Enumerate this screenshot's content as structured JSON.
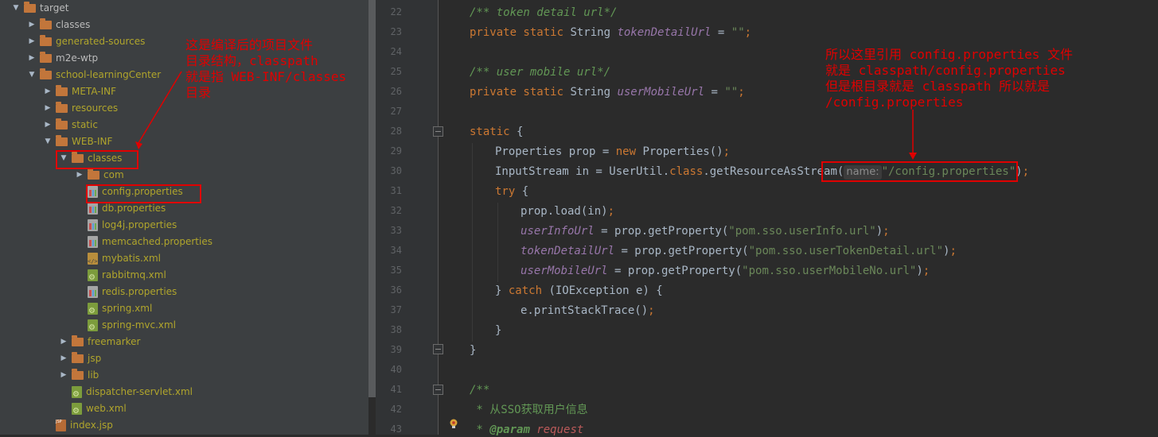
{
  "tree": {
    "items": [
      {
        "label": "target",
        "kind": "folder",
        "expanded": true,
        "color": "white"
      },
      {
        "label": "classes",
        "kind": "folder",
        "expanded": false,
        "color": "white"
      },
      {
        "label": "generated-sources",
        "kind": "folder",
        "expanded": false,
        "color": "yellow"
      },
      {
        "label": "m2e-wtp",
        "kind": "folder",
        "expanded": false,
        "color": "white"
      },
      {
        "label": "school-learningCenter",
        "kind": "folder",
        "expanded": true,
        "color": "yellow"
      },
      {
        "label": "META-INF",
        "kind": "folder",
        "expanded": false,
        "color": "yellow"
      },
      {
        "label": "resources",
        "kind": "folder",
        "expanded": false,
        "color": "yellow"
      },
      {
        "label": "static",
        "kind": "folder",
        "expanded": false,
        "color": "yellow"
      },
      {
        "label": "WEB-INF",
        "kind": "folder",
        "expanded": true,
        "color": "yellow"
      },
      {
        "label": "classes",
        "kind": "folder",
        "expanded": true,
        "color": "yellow"
      },
      {
        "label": "com",
        "kind": "folder",
        "expanded": false,
        "color": "yellow"
      },
      {
        "label": "config.properties",
        "kind": "properties",
        "color": "yellow"
      },
      {
        "label": "db.properties",
        "kind": "properties",
        "color": "yellow"
      },
      {
        "label": "log4j.properties",
        "kind": "properties",
        "color": "yellow"
      },
      {
        "label": "memcached.properties",
        "kind": "properties",
        "color": "yellow"
      },
      {
        "label": "mybatis.xml",
        "kind": "xml",
        "color": "yellow"
      },
      {
        "label": "rabbitmq.xml",
        "kind": "xml-green",
        "color": "yellow"
      },
      {
        "label": "redis.properties",
        "kind": "properties",
        "color": "yellow"
      },
      {
        "label": "spring.xml",
        "kind": "xml-green",
        "color": "yellow"
      },
      {
        "label": "spring-mvc.xml",
        "kind": "xml-green",
        "color": "yellow"
      },
      {
        "label": "freemarker",
        "kind": "folder",
        "expanded": false,
        "color": "yellow"
      },
      {
        "label": "jsp",
        "kind": "folder",
        "expanded": false,
        "color": "yellow"
      },
      {
        "label": "lib",
        "kind": "folder",
        "expanded": false,
        "color": "yellow"
      },
      {
        "label": "dispatcher-servlet.xml",
        "kind": "xml-green",
        "color": "yellow"
      },
      {
        "label": "web.xml",
        "kind": "xml-green",
        "color": "yellow"
      },
      {
        "label": "index.jsp",
        "kind": "jsp",
        "color": "yellow"
      }
    ]
  },
  "editor": {
    "line_numbers": [
      "22",
      "23",
      "24",
      "25",
      "26",
      "27",
      "28",
      "29",
      "30",
      "31",
      "32",
      "33",
      "34",
      "35",
      "36",
      "37",
      "38",
      "39",
      "40",
      "41",
      "42",
      "43"
    ],
    "lines": {
      "l22_comment": "/** token detail url*/",
      "l23_kw": "private static ",
      "l23_type": "String ",
      "l23_field": "tokenDetailUrl",
      "l23_eq": " = ",
      "l23_str": "\"\"",
      "l23_semi": ";",
      "l25_comment": "/** user mobile url*/",
      "l26_kw": "private static ",
      "l26_type": "String ",
      "l26_field": "userMobileUrl",
      "l26_eq": " = ",
      "l26_str": "\"\"",
      "l26_semi": ";",
      "l28_kw": "static",
      "l28_brace": " {",
      "l29_a": "Properties prop = ",
      "l29_kw": "new",
      "l29_b": " Properties()",
      "l29_semi": ";",
      "l30_a": "InputStream in = UserUtil.",
      "l30_kw": "class",
      "l30_b": ".getResourceAsStream(",
      "l30_hint": "name:",
      "l30_str": "\"/config.properties\"",
      "l30_c": ")",
      "l30_semi": ";",
      "l31_kw": "try",
      "l31_brace": " {",
      "l32_a": "prop.load(in)",
      "l32_semi": ";",
      "l33_field": "userInfoUrl",
      "l33_a": " = prop.getProperty(",
      "l33_str": "\"pom.sso.userInfo.url\"",
      "l33_b": ")",
      "l33_semi": ";",
      "l34_field": "tokenDetailUrl",
      "l34_a": " = prop.getProperty(",
      "l34_str": "\"pom.sso.userTokenDetail.url\"",
      "l34_b": ")",
      "l34_semi": ";",
      "l35_field": "userMobileUrl",
      "l35_a": " = prop.getProperty(",
      "l35_str": "\"pom.sso.userMobileNo.url\"",
      "l35_b": ")",
      "l35_semi": ";",
      "l36_a": "} ",
      "l36_kw": "catch",
      "l36_b": " (IOException e) {",
      "l37_a": "e.printStackTrace()",
      "l37_semi": ";",
      "l38": "}",
      "l39": "}",
      "l41_comment": "/**",
      "l42_comment": " * 从SSO获取用户信息",
      "l43_star": " * ",
      "l43_tag": "@param",
      "l43_name": " request"
    }
  },
  "annotations": {
    "left_note": "这是编译后的项目文件\n目录结构，classpath\n就是指 WEB-INF/classes\n目录",
    "right_note": "所以这里引用 config.properties 文件\n就是 classpath/config.properties\n但是根目录就是 classpath 所以就是\n/config.properties",
    "color": "#e00000"
  }
}
